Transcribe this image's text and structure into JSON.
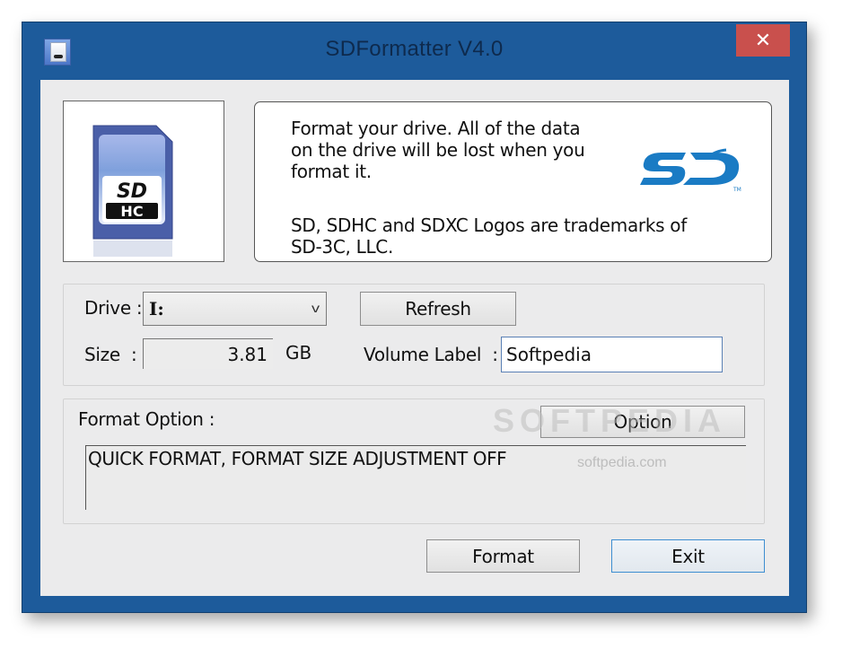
{
  "window": {
    "title": "SDFormatter V4.0",
    "close_glyph": "✕"
  },
  "info": {
    "description": "Format your drive. All of the data\non the drive will be lost when you\nformat it.",
    "trademark": "SD, SDHC and SDXC Logos are trademarks of\nSD-3C, LLC.",
    "card_image_label": "SDHC",
    "logo_label": "SD"
  },
  "drive_group": {
    "drive_label": "Drive :",
    "drive_value": "I:",
    "refresh_label": "Refresh",
    "size_label": "Size  :",
    "size_value": "3.81",
    "size_unit": "GB",
    "volume_label_label": "Volume Label  :",
    "volume_label_value": "Softpedia"
  },
  "format_group": {
    "label": "Format Option :",
    "option_button": "Option",
    "option_text": "QUICK FORMAT, FORMAT SIZE ADJUSTMENT OFF"
  },
  "actions": {
    "format_label": "Format",
    "exit_label": "Exit"
  },
  "watermark": {
    "main": "SOFTPEDIA",
    "sub": "softpedia.com"
  },
  "colors": {
    "frame": "#1d5b9b",
    "close": "#c9504d",
    "sd_logo": "#1a7bc4",
    "focus_border": "#5a80b5"
  }
}
